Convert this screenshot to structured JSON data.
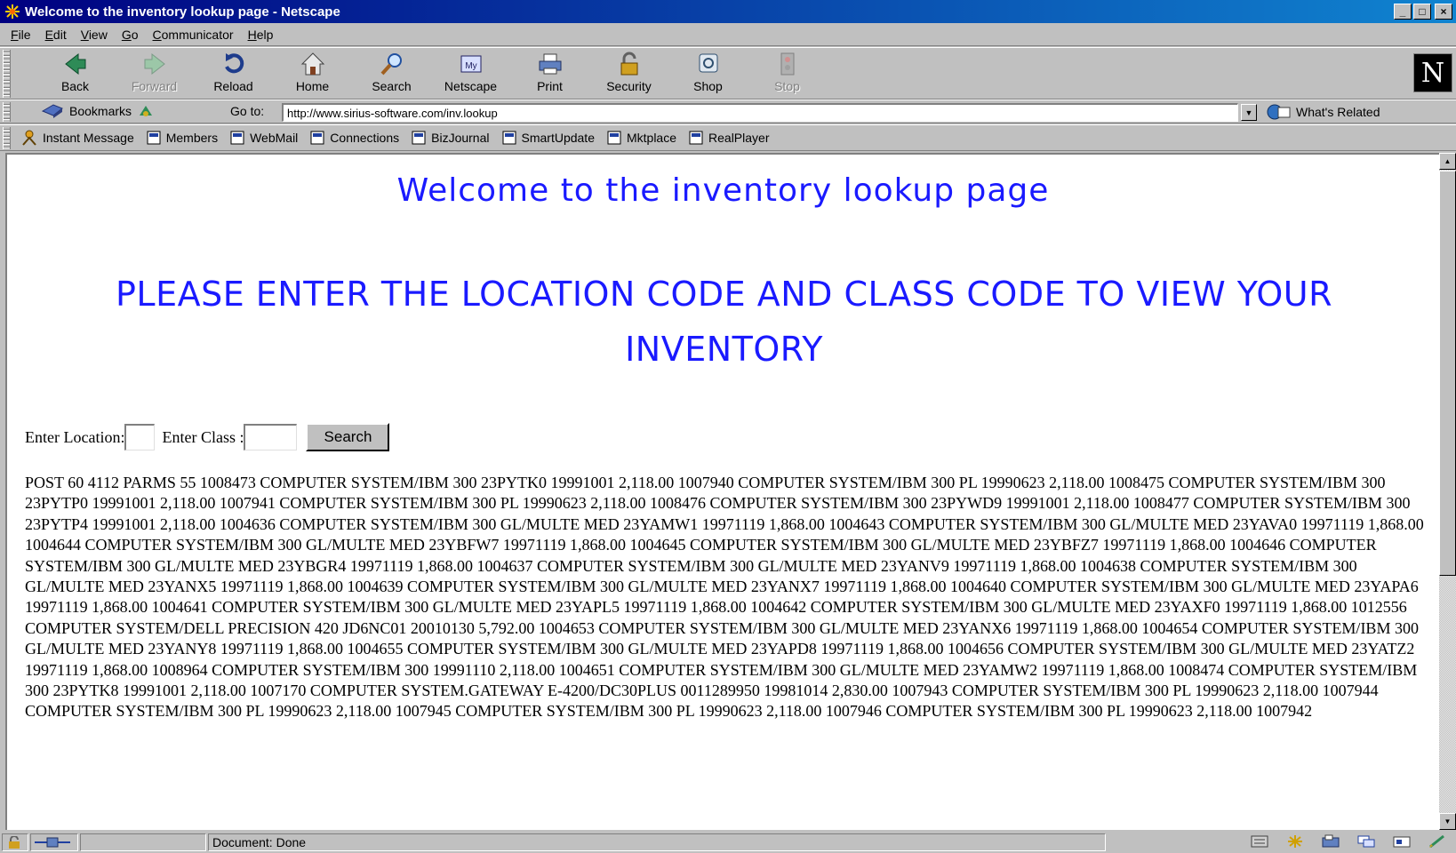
{
  "window": {
    "title": "Welcome to the inventory lookup page - Netscape",
    "minimize": "_",
    "maximize": "□",
    "close": "×"
  },
  "menu": {
    "items": [
      {
        "acc": "F",
        "rest": "ile"
      },
      {
        "acc": "E",
        "rest": "dit"
      },
      {
        "acc": "V",
        "rest": "iew"
      },
      {
        "acc": "G",
        "rest": "o"
      },
      {
        "acc": "C",
        "rest": "ommunicator"
      },
      {
        "acc": "H",
        "rest": "elp"
      }
    ]
  },
  "nav_toolbar": {
    "back": "Back",
    "forward": "Forward",
    "reload": "Reload",
    "home": "Home",
    "search": "Search",
    "netscape": "Netscape",
    "print": "Print",
    "security": "Security",
    "shop": "Shop",
    "stop": "Stop",
    "my_badge": "My",
    "throbber": "N"
  },
  "location_toolbar": {
    "bookmarks": "Bookmarks",
    "goto_label": "Go to:",
    "url": "http://www.sirius-software.com/inv.lookup",
    "whats_related": "What's Related"
  },
  "personal_toolbar": {
    "instant_message": "Instant Message",
    "members": "Members",
    "webmail": "WebMail",
    "connections": "Connections",
    "bizjournal": "BizJournal",
    "smartupdate": "SmartUpdate",
    "mktplace": "Mktplace",
    "realplayer": "RealPlayer"
  },
  "page": {
    "welcome": "Welcome to the inventory lookup page",
    "instruction": "PLEASE ENTER THE LOCATION CODE AND CLASS CODE TO VIEW YOUR INVENTORY",
    "location_label": "Enter Location:",
    "location_value": "",
    "class_label": "Enter Class :",
    "class_value": "",
    "search_button": "Search",
    "results": "POST 60 4112 PARMS 55 1008473 COMPUTER SYSTEM/IBM 300 23PYTK0 19991001 2,118.00 1007940 COMPUTER SYSTEM/IBM 300 PL 19990623 2,118.00 1008475 COMPUTER SYSTEM/IBM 300 23PYTP0 19991001 2,118.00 1007941 COMPUTER SYSTEM/IBM 300 PL 19990623 2,118.00 1008476 COMPUTER SYSTEM/IBM 300 23PYWD9 19991001 2,118.00 1008477 COMPUTER SYSTEM/IBM 300 23PYTP4 19991001 2,118.00 1004636 COMPUTER SYSTEM/IBM 300 GL/MULTE MED 23YAMW1 19971119 1,868.00 1004643 COMPUTER SYSTEM/IBM 300 GL/MULTE MED 23YAVA0 19971119 1,868.00 1004644 COMPUTER SYSTEM/IBM 300 GL/MULTE MED 23YBFW7 19971119 1,868.00 1004645 COMPUTER SYSTEM/IBM 300 GL/MULTE MED 23YBFZ7 19971119 1,868.00 1004646 COMPUTER SYSTEM/IBM 300 GL/MULTE MED 23YBGR4 19971119 1,868.00 1004637 COMPUTER SYSTEM/IBM 300 GL/MULTE MED 23YANV9 19971119 1,868.00 1004638 COMPUTER SYSTEM/IBM 300 GL/MULTE MED 23YANX5 19971119 1,868.00 1004639 COMPUTER SYSTEM/IBM 300 GL/MULTE MED 23YANX7 19971119 1,868.00 1004640 COMPUTER SYSTEM/IBM 300 GL/MULTE MED 23YAPA6 19971119 1,868.00 1004641 COMPUTER SYSTEM/IBM 300 GL/MULTE MED 23YAPL5 19971119 1,868.00 1004642 COMPUTER SYSTEM/IBM 300 GL/MULTE MED 23YAXF0 19971119 1,868.00 1012556 COMPUTER SYSTEM/DELL PRECISION 420 JD6NC01 20010130 5,792.00 1004653 COMPUTER SYSTEM/IBM 300 GL/MULTE MED 23YANX6 19971119 1,868.00 1004654 COMPUTER SYSTEM/IBM 300 GL/MULTE MED 23YANY8 19971119 1,868.00 1004655 COMPUTER SYSTEM/IBM 300 GL/MULTE MED 23YAPD8 19971119 1,868.00 1004656 COMPUTER SYSTEM/IBM 300 GL/MULTE MED 23YATZ2 19971119 1,868.00 1008964 COMPUTER SYSTEM/IBM 300 19991110 2,118.00 1004651 COMPUTER SYSTEM/IBM 300 GL/MULTE MED 23YAMW2 19971119 1,868.00 1008474 COMPUTER SYSTEM/IBM 300 23PYTK8 19991001 2,118.00 1007170 COMPUTER SYSTEM.GATEWAY E-4200/DC30PLUS 0011289950 19981014 2,830.00 1007943 COMPUTER SYSTEM/IBM 300 PL 19990623 2,118.00 1007944 COMPUTER SYSTEM/IBM 300 PL 19990623 2,118.00 1007945 COMPUTER SYSTEM/IBM 300 PL 19990623 2,118.00 1007946 COMPUTER SYSTEM/IBM 300 PL 19990623 2,118.00 1007942"
  },
  "status": {
    "text": "Document: Done"
  },
  "colors": {
    "heading": "#1a1aff",
    "title_bar_start": "#000080",
    "title_bar_end": "#1084d0",
    "chrome": "#c0c0c0"
  }
}
